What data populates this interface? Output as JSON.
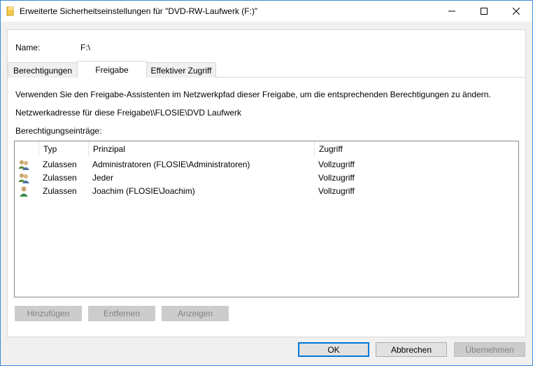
{
  "window": {
    "title": "Erweiterte Sicherheitseinstellungen für \"DVD-RW-Laufwerk (F:)\""
  },
  "object": {
    "name_label": "Name:",
    "name_value": "F:\\"
  },
  "tabs": [
    {
      "label": "Berechtigungen",
      "active": false
    },
    {
      "label": "Freigabe",
      "active": true
    },
    {
      "label": "Effektiver Zugriff",
      "active": false
    }
  ],
  "share": {
    "description": "Verwenden Sie den Freigabe-Assistenten im Netzwerkpfad dieser Freigabe, um die entsprechenden Berechtigungen zu ändern.",
    "network_address_label": "Netzwerkadresse für diese Freigabe:",
    "network_address_value": "\\\\FLOSIE\\DVD Laufwerk",
    "entries_label": "Berechtigungseinträge:"
  },
  "table": {
    "columns": [
      "Typ",
      "Prinzipal",
      "Zugriff"
    ],
    "rows": [
      {
        "icon": "user-group-icon",
        "type": "Zulassen",
        "principal": "Administratoren (FLOSIE\\Administratoren)",
        "access": "Vollzugriff"
      },
      {
        "icon": "user-group-icon",
        "type": "Zulassen",
        "principal": "Jeder",
        "access": "Vollzugriff"
      },
      {
        "icon": "user-icon",
        "type": "Zulassen",
        "principal": "Joachim (FLOSIE\\Joachim)",
        "access": "Vollzugriff"
      }
    ]
  },
  "entry_buttons": {
    "add": "Hinzufügen",
    "remove": "Entfernen",
    "view": "Anzeigen"
  },
  "dialog_buttons": {
    "ok": "OK",
    "cancel": "Abbrechen",
    "apply": "Übernehmen"
  },
  "colors": {
    "accent": "#0078d7",
    "window_border": "#3a8ad8",
    "disabled_button": "#cccccc"
  }
}
